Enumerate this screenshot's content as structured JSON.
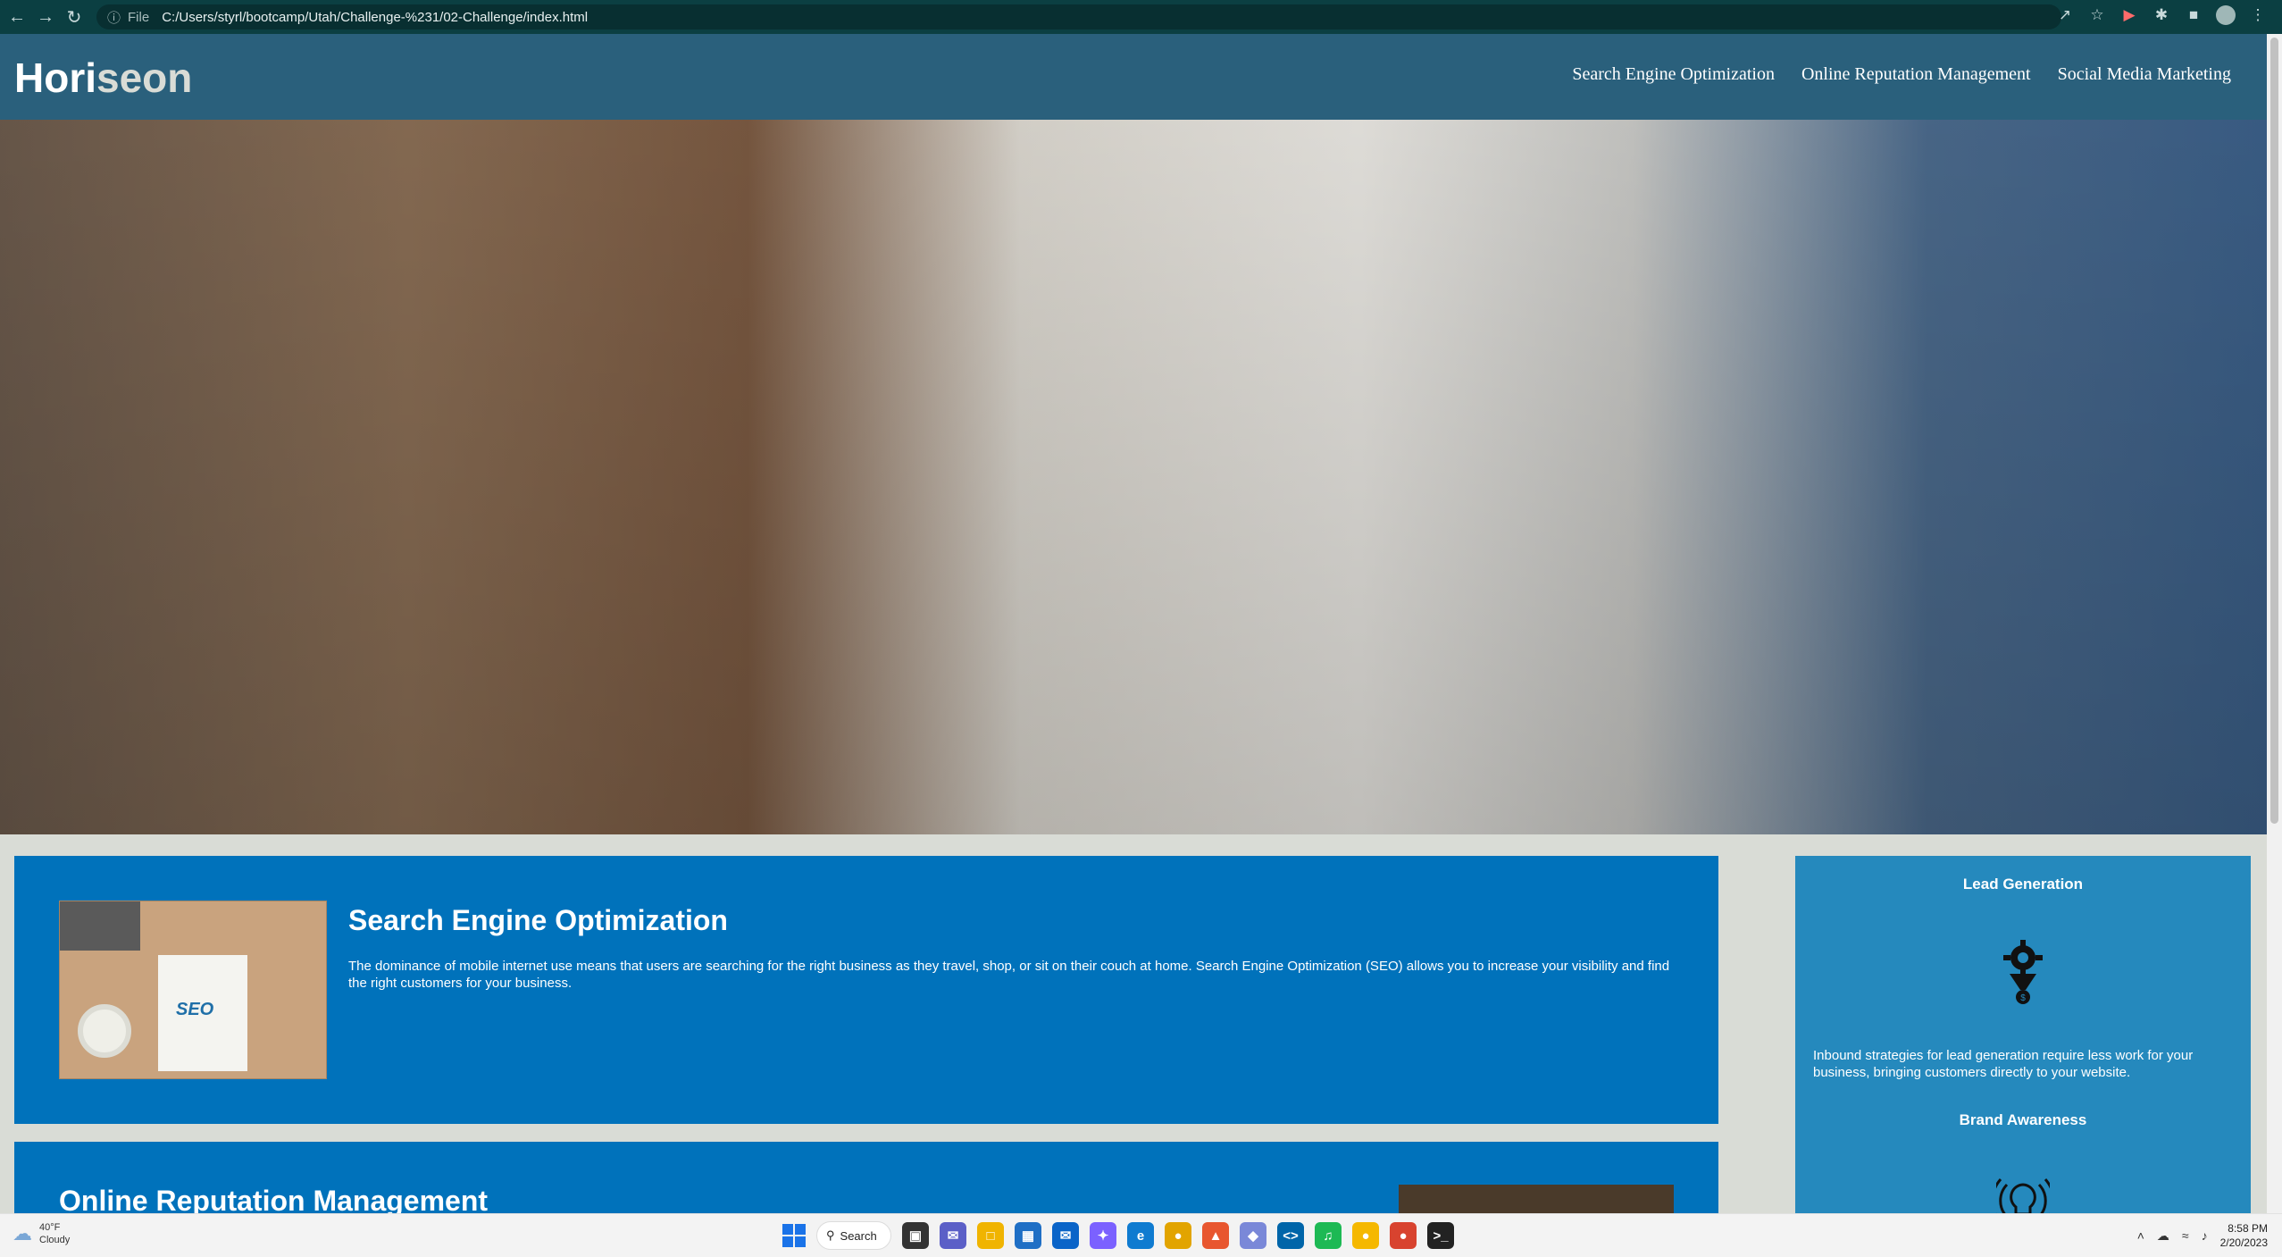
{
  "browser": {
    "file_label": "File",
    "url": "C:/Users/styrl/bootcamp/Utah/Challenge-%231/02-Challenge/index.html",
    "nav_icons": [
      "back-arrow-icon",
      "forward-arrow-icon",
      "reload-icon"
    ],
    "tool_icons": [
      "share-icon",
      "star-icon",
      "extension-icon",
      "puzzle-icon",
      "sidebar-icon",
      "profile-avatar-icon",
      "menu-dots-icon"
    ]
  },
  "header": {
    "logo_main": "Hori",
    "logo_accent": "seon",
    "nav": [
      {
        "label": "Search Engine Optimization"
      },
      {
        "label": "Online Reputation Management"
      },
      {
        "label": "Social Media Marketing"
      }
    ]
  },
  "main": {
    "seo": {
      "title": "Search Engine Optimization",
      "text": "The dominance of mobile internet use means that users are searching for the right business as they travel, shop, or sit on their couch at home. Search Engine Optimization (SEO) allows you to increase your visibility and find the right customers for your business.",
      "image_word": "SEO"
    },
    "orm": {
      "title": "Online Reputation Management"
    }
  },
  "sidebar": {
    "lead_title": "Lead Generation",
    "lead_text": "Inbound strategies for lead generation require less work for your business, bringing customers directly to your website.",
    "brand_title": "Brand Awareness"
  },
  "taskbar": {
    "weather_temp": "40°F",
    "weather_desc": "Cloudy",
    "search_label": "Search",
    "time": "8:58 PM",
    "date": "2/20/2023"
  },
  "colors": {
    "header_bg": "#2a607c",
    "card_bg": "#0072bb",
    "sidebar_bg": "#2589bd",
    "page_bg": "#d9dcd6"
  }
}
